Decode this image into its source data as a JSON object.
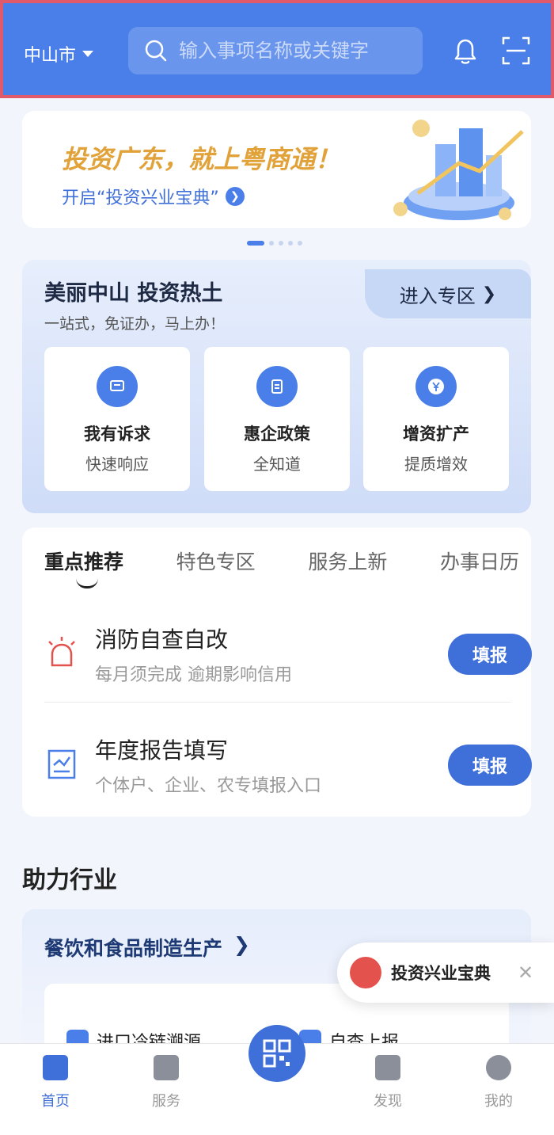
{
  "header": {
    "city": "中山市",
    "search_placeholder": "输入事项名称或关键字"
  },
  "banner": {
    "title": "投资广东，就上粤商通！",
    "subtitle": "开启“投资兴业宝典”"
  },
  "zone": {
    "title": "美丽中山 投资热土",
    "subtitle": "一站式，免证办，马上办！",
    "enter_label": "进入专区",
    "cards": [
      {
        "title": "我有诉求",
        "sub": "快速响应"
      },
      {
        "title": "惠企政策",
        "sub": "全知道"
      },
      {
        "title": "增资扩产",
        "sub": "提质增效"
      }
    ]
  },
  "recommend": {
    "tabs": [
      "重点推荐",
      "特色专区",
      "服务上新",
      "办事日历"
    ],
    "items": [
      {
        "title": "消防自查自改",
        "sub": "每月须完成 逾期影响信用",
        "button": "填报"
      },
      {
        "title": "年度报告填写",
        "sub": "个体户、企业、农专填报入口",
        "button": "填报"
      }
    ]
  },
  "industry": {
    "section_title": "助力行业",
    "card_title": "餐饮和食品制造生产",
    "items": [
      "进口冷链溯源",
      "自查上报"
    ]
  },
  "floating": {
    "label": "投资兴业宝典",
    "close": "✕"
  },
  "nav": {
    "items": [
      "首页",
      "服务",
      "发现",
      "我的"
    ]
  },
  "colors": {
    "primary": "#4a7ee8",
    "accent_gold": "#e2a23a",
    "alert_red": "#e4524e"
  }
}
